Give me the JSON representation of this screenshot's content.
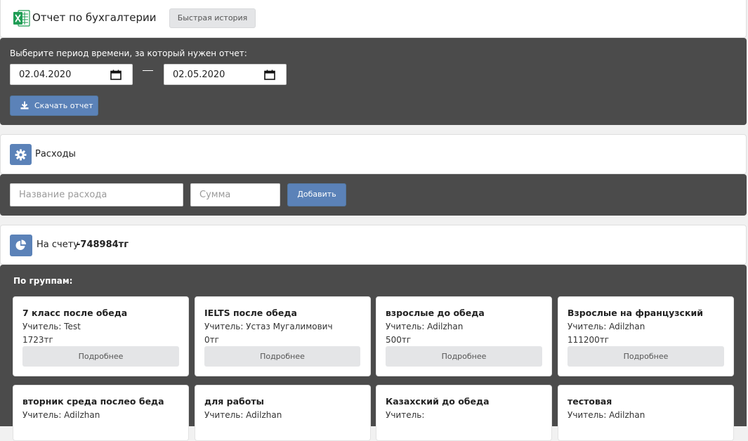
{
  "report": {
    "title": "Отчет по бухгалтерии",
    "quick_history_label": "Быстрая история",
    "icon": "excel-icon"
  },
  "period": {
    "prompt": "Выберите период времени, за который нужен отчет:",
    "date_from": "02.04.2020",
    "date_to": "02.05.2020",
    "download_label": "Скачать отчет"
  },
  "expenses": {
    "title": "Расходы",
    "name_placeholder": "Название расхода",
    "sum_placeholder": "Сумма",
    "add_label": "Добавить",
    "icon": "gear-icon"
  },
  "balance": {
    "label": "На счету",
    "value": "-748984тг",
    "icon": "pie-chart-icon"
  },
  "groups": {
    "title": "По группам:",
    "more_label": "Подробнее",
    "items": [
      {
        "name": "7 класс после обеда",
        "teacher": "Учитель: Test",
        "sum": "1723тг"
      },
      {
        "name": "IELTS после обеда",
        "teacher": "Учитель: Устаз Мугалимович",
        "sum": "0тг"
      },
      {
        "name": "взрослые до обеда",
        "teacher": "Учитель: Adilzhan",
        "sum": "500тг"
      },
      {
        "name": "Взрослые на французский",
        "teacher": "Учитель: Adilzhan",
        "sum": "111200тг"
      },
      {
        "name": "вторник среда послео беда",
        "teacher": "Учитель: Adilzhan",
        "sum": ""
      },
      {
        "name": "для работы",
        "teacher": "Учитель: Adilzhan",
        "sum": ""
      },
      {
        "name": "Казахский до обеда",
        "teacher": "Учитель:",
        "sum": ""
      },
      {
        "name": "тестовая",
        "teacher": "Учитель: Adilzhan",
        "sum": ""
      }
    ]
  },
  "colors": {
    "accent": "#5b82b8",
    "dark_panel": "#4b4b4b",
    "excel_green": "#1f9d55"
  }
}
